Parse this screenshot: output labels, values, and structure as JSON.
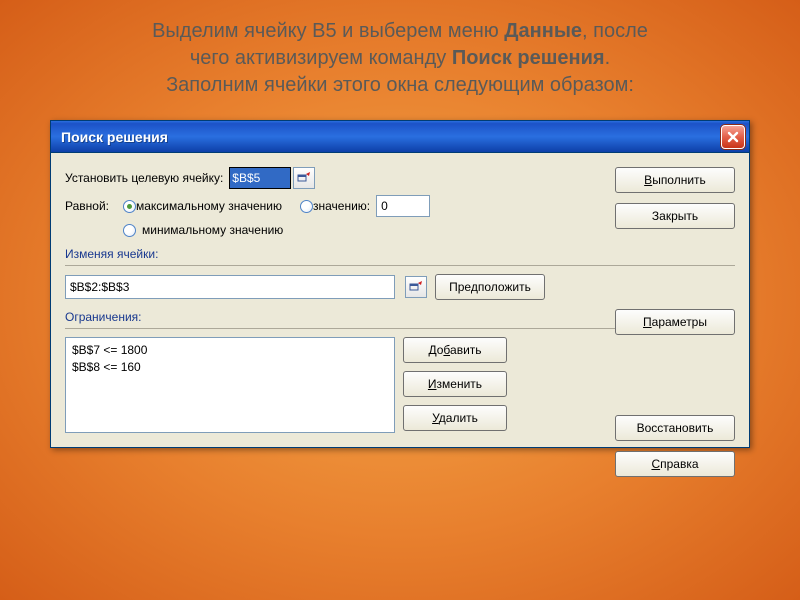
{
  "instruction": {
    "line1_a": "Выделим ячейку B5 и выберем меню ",
    "line1_b": "Данные",
    "line1_c": ", после",
    "line2_a": "чего активизируем команду ",
    "line2_b": "Поиск решения",
    "line2_c": ".",
    "line3": "Заполним ячейки этого окна следующим образом:"
  },
  "dialog": {
    "title": "Поиск решения",
    "target_label": "Установить целевую ячейку:",
    "target_value": "$B$5",
    "equal_label": "Равной:",
    "radio_max": "максимальному значению",
    "radio_val": "значению:",
    "radio_min": "минимальному значению",
    "val_input": "0",
    "changing_label": "Изменяя ячейки:",
    "changing_value": "$B$2:$B$3",
    "guess_btn": "Предположить",
    "constraints_label": "Ограничения:",
    "constraints": [
      "$B$7 <= 1800",
      "$B$8 <= 160"
    ],
    "add_btn_pre": "До",
    "add_btn_u": "б",
    "add_btn_post": "авить",
    "edit_btn_pre": "",
    "edit_btn_u": "И",
    "edit_btn_post": "зменить",
    "del_btn_pre": "",
    "del_btn_u": "У",
    "del_btn_post": "далить",
    "run_btn_pre": "",
    "run_btn_u": "В",
    "run_btn_post": "ыполнить",
    "close_btn": "Закрыть",
    "params_btn_pre": "",
    "params_btn_u": "П",
    "params_btn_post": "араметры",
    "restore_btn": "Восстановить",
    "help_btn_pre": "",
    "help_btn_u": "С",
    "help_btn_post": "правка"
  }
}
